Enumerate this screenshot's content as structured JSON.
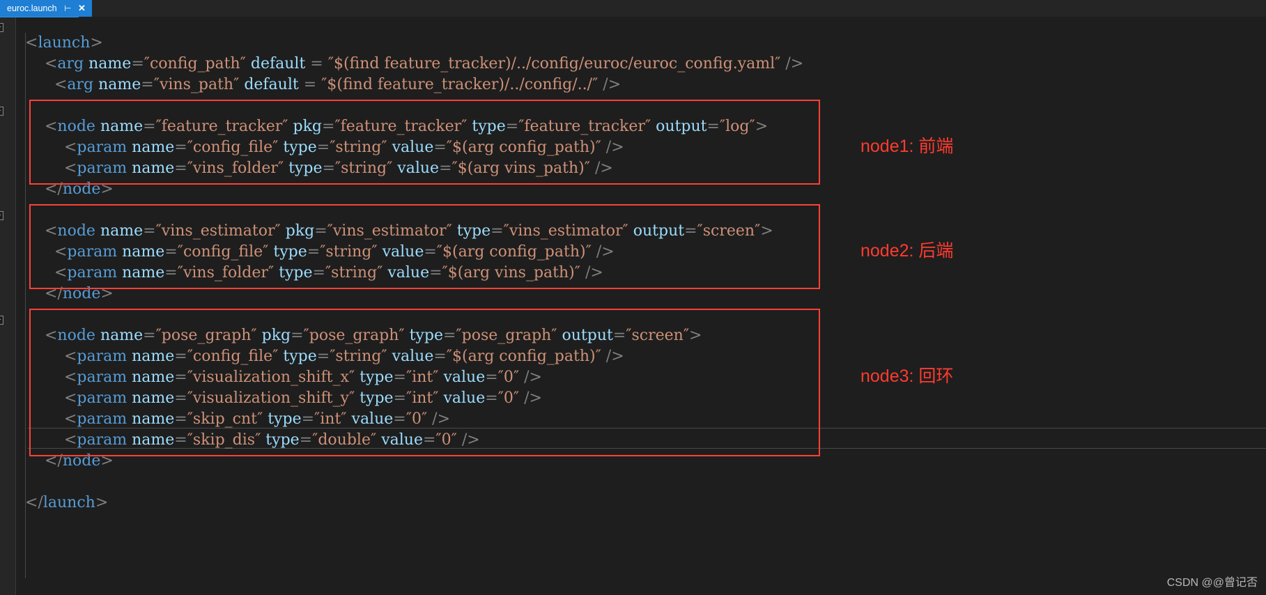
{
  "window": {
    "background": "#1e1e1e",
    "accent": "#1e7fd4",
    "annotation_color": "#ff3b30",
    "box_color": "#ff4136"
  },
  "tab": {
    "label": "euroc.launch",
    "pin_icon": "pin-icon",
    "close_icon": "close-icon"
  },
  "code": {
    "language": "xml",
    "lines": [
      {
        "indent": 0,
        "fold": true,
        "text": "<launch>"
      },
      {
        "indent": 2,
        "fold": false,
        "text": "<arg name=\"config_path\" default = \"$(find feature_tracker)/../config/euroc/euroc_config.yaml\" />"
      },
      {
        "indent": 3,
        "fold": false,
        "text": "<arg name=\"vins_path\" default = \"$(find feature_tracker)/../config/../\" />"
      },
      {
        "indent": 0,
        "fold": false,
        "text": ""
      },
      {
        "indent": 2,
        "fold": true,
        "text": "<node name=\"feature_tracker\" pkg=\"feature_tracker\" type=\"feature_tracker\" output=\"log\">"
      },
      {
        "indent": 4,
        "fold": false,
        "text": "<param name=\"config_file\" type=\"string\" value=\"$(arg config_path)\" />"
      },
      {
        "indent": 4,
        "fold": false,
        "text": "<param name=\"vins_folder\" type=\"string\" value=\"$(arg vins_path)\" />"
      },
      {
        "indent": 2,
        "fold": false,
        "text": "</node>"
      },
      {
        "indent": 0,
        "fold": false,
        "text": ""
      },
      {
        "indent": 2,
        "fold": true,
        "text": "<node name=\"vins_estimator\" pkg=\"vins_estimator\" type=\"vins_estimator\" output=\"screen\">"
      },
      {
        "indent": 3,
        "fold": false,
        "text": "<param name=\"config_file\" type=\"string\" value=\"$(arg config_path)\" />"
      },
      {
        "indent": 3,
        "fold": false,
        "text": "<param name=\"vins_folder\" type=\"string\" value=\"$(arg vins_path)\" />"
      },
      {
        "indent": 2,
        "fold": false,
        "text": "</node>"
      },
      {
        "indent": 0,
        "fold": false,
        "text": ""
      },
      {
        "indent": 2,
        "fold": true,
        "text": "<node name=\"pose_graph\" pkg=\"pose_graph\" type=\"pose_graph\" output=\"screen\">"
      },
      {
        "indent": 4,
        "fold": false,
        "text": "<param name=\"config_file\" type=\"string\" value=\"$(arg config_path)\" />"
      },
      {
        "indent": 4,
        "fold": false,
        "text": "<param name=\"visualization_shift_x\" type=\"int\" value=\"0\" />"
      },
      {
        "indent": 4,
        "fold": false,
        "text": "<param name=\"visualization_shift_y\" type=\"int\" value=\"0\" />"
      },
      {
        "indent": 4,
        "fold": false,
        "text": "<param name=\"skip_cnt\" type=\"int\" value=\"0\" />"
      },
      {
        "indent": 4,
        "fold": false,
        "text": "<param name=\"skip_dis\" type=\"double\" value=\"0\" />"
      },
      {
        "indent": 2,
        "fold": false,
        "text": "</node>"
      },
      {
        "indent": 0,
        "fold": false,
        "text": ""
      },
      {
        "indent": 0,
        "fold": false,
        "text": "</launch>"
      }
    ]
  },
  "annotations": [
    {
      "id": "node1",
      "label": "node1: 前端"
    },
    {
      "id": "node2",
      "label": "node2: 后端"
    },
    {
      "id": "node3",
      "label": "node3: 回环"
    }
  ],
  "watermark": {
    "text": "CSDN @@曾记否"
  }
}
